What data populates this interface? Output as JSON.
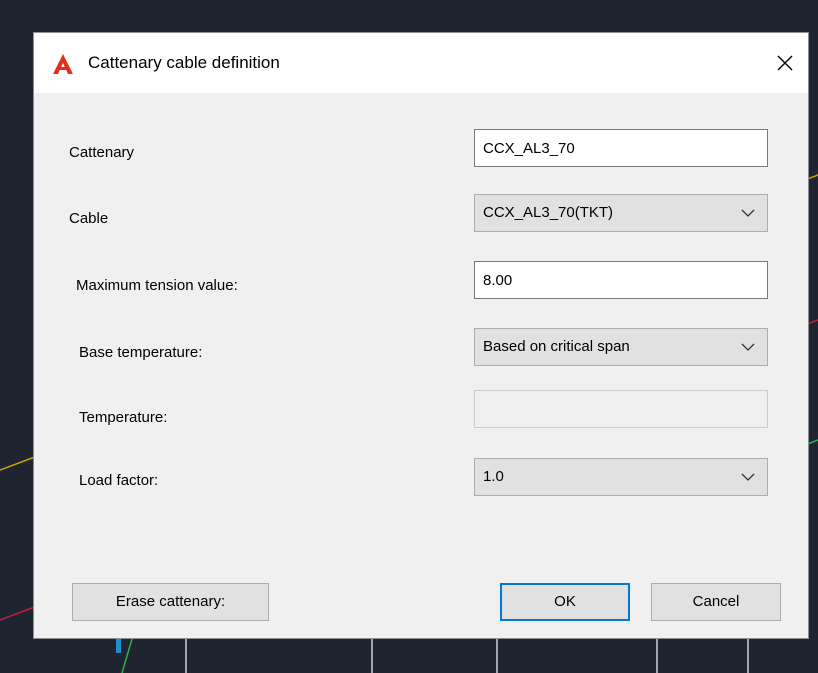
{
  "dialog": {
    "title": "Cattenary cable definition",
    "icon": "autocad-logo-icon",
    "close_icon": "close-icon"
  },
  "form": {
    "cattenary_label": "Cattenary",
    "cattenary_value": "CCX_AL3_70",
    "cable_label": "Cable",
    "cable_value": "CCX_AL3_70(TKT)",
    "max_tension_label": "Maximum tension value:",
    "max_tension_value": "8.00",
    "base_temp_label": "Base temperature:",
    "base_temp_value": "Based on critical span",
    "temperature_label": "Temperature:",
    "temperature_value": "",
    "load_factor_label": "Load factor:",
    "load_factor_value": "1.0"
  },
  "buttons": {
    "erase": "Erase cattenary:",
    "ok": "OK",
    "cancel": "Cancel"
  },
  "colors": {
    "accent": "#0078d7",
    "app_icon": "#e0301e",
    "background": "#1e2530"
  }
}
